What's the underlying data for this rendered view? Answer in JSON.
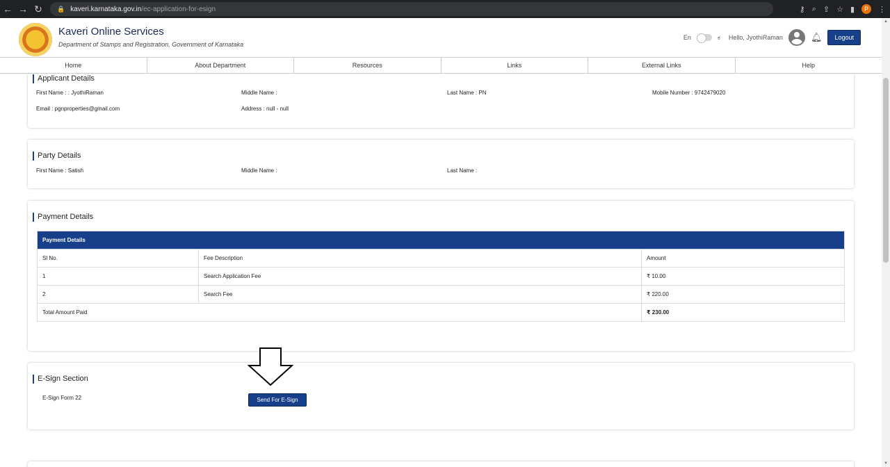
{
  "browser": {
    "url_host": "kaveri.karnataka.gov.in",
    "url_path": "/ec-application-for-esign",
    "profile_initial": "P"
  },
  "header": {
    "title": "Kaveri Online Services",
    "subtitle": "Department of Stamps and Registration, Government of Karnataka",
    "lang_en": "En",
    "lang_kn": "ಕ",
    "greeting": "Hello, JyothiRaman",
    "logout_label": "Logout"
  },
  "nav": [
    "Home",
    "About Department",
    "Resources",
    "Links",
    "External Links",
    "Help"
  ],
  "applicant": {
    "title": "Applicant Details",
    "first_name": "First Name : : JyothiRaman",
    "middle_name": "Middle Name :",
    "last_name": "Last Name : PN",
    "mobile": "Mobile Number : 9742479020",
    "email": "Email : pgnproperties@gmail.com",
    "address": "Address : null - null"
  },
  "party": {
    "title": "Party Details",
    "first_name": "First Name : Satish",
    "middle_name": "Middle Name :",
    "last_name": "Last Name :"
  },
  "payment": {
    "title": "Payment Details",
    "table_title": "Payment Details",
    "headers": [
      "Sl No.",
      "Fee Description",
      "Amount"
    ],
    "rows": [
      {
        "sl": "1",
        "desc": "Search Application Fee",
        "amount": "₹ 10.00"
      },
      {
        "sl": "2",
        "desc": "Search Fee",
        "amount": "₹ 220.00"
      }
    ],
    "total_label": "Total Amount Paid",
    "total_amount": "₹ 230.00"
  },
  "esign": {
    "title": "E-Sign Section",
    "form_label": "E-Sign Form 22",
    "button_label": "Send For E-Sign"
  },
  "colors": {
    "primary": "#173f8a",
    "chrome": "#202124"
  }
}
